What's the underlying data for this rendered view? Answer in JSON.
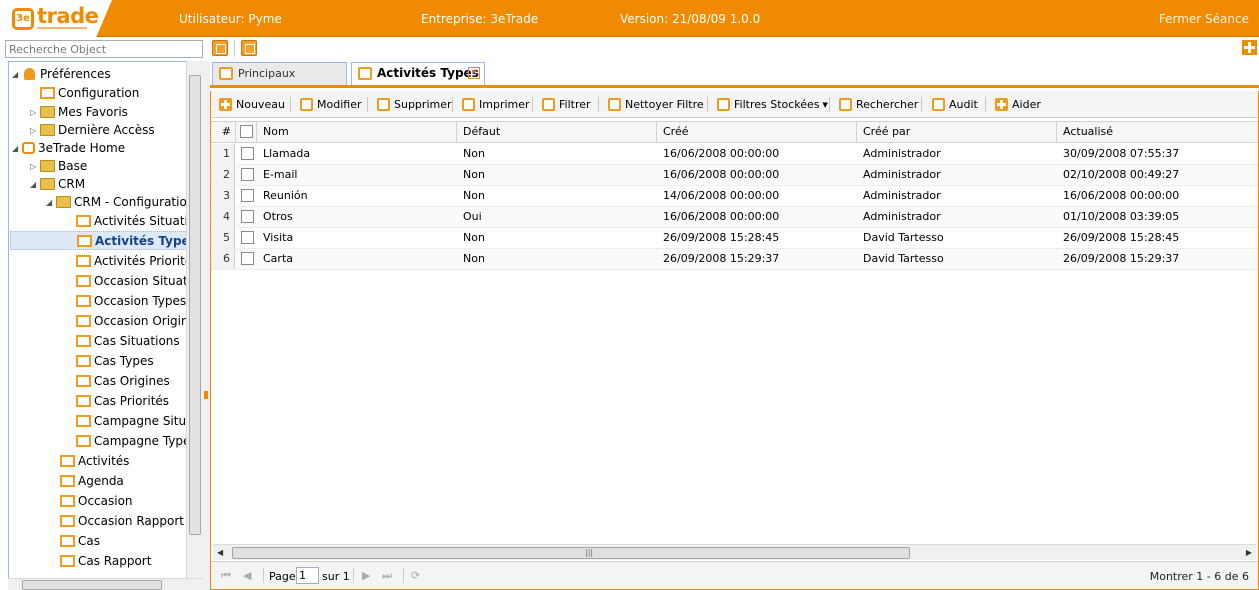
{
  "header": {
    "logo_text": "trade",
    "logo_mark": "3e",
    "user": "Utilisateur: Pyme",
    "company": "Entreprise: 3eTrade",
    "version": "Version: 21/08/09 1.0.0",
    "logout": "Fermer Séance"
  },
  "search": {
    "placeholder": "Recherche Object"
  },
  "tree": {
    "nodes": [
      {
        "label": "Préférences",
        "expanded": true,
        "icon": "user-icon"
      },
      {
        "label": "Configuration",
        "icon": "form-icon"
      },
      {
        "label": "Mes Favoris",
        "icon": "folder-icon"
      },
      {
        "label": "Dernière Accèss",
        "icon": "folder-icon"
      },
      {
        "label": "3eTrade Home",
        "expanded": true,
        "icon": "brand-icon"
      },
      {
        "label": "Base",
        "icon": "folder-icon"
      },
      {
        "label": "CRM",
        "expanded": true,
        "icon": "folder-icon"
      },
      {
        "label": "CRM - Configuration",
        "expanded": true,
        "icon": "folder-icon"
      },
      {
        "label": "Activités Situation",
        "icon": "form-icon"
      },
      {
        "label": "Activités Types",
        "icon": "form-icon",
        "selected": true
      },
      {
        "label": "Activités Priorités",
        "icon": "form-icon"
      },
      {
        "label": "Occasion Situation",
        "icon": "form-icon"
      },
      {
        "label": "Occasion Types",
        "icon": "form-icon"
      },
      {
        "label": "Occasion Origine",
        "icon": "form-icon"
      },
      {
        "label": "Cas Situations",
        "icon": "form-icon"
      },
      {
        "label": "Cas Types",
        "icon": "form-icon"
      },
      {
        "label": "Cas Origines",
        "icon": "form-icon"
      },
      {
        "label": "Cas Priorités",
        "icon": "form-icon"
      },
      {
        "label": "Campagne Situation",
        "icon": "form-icon"
      },
      {
        "label": "Campagne Types",
        "icon": "form-icon"
      },
      {
        "label": "Activités",
        "icon": "form-icon"
      },
      {
        "label": "Agenda",
        "icon": "form-icon"
      },
      {
        "label": "Occasion",
        "icon": "form-icon"
      },
      {
        "label": "Occasion Rapport",
        "icon": "form-icon"
      },
      {
        "label": "Cas",
        "icon": "form-icon"
      },
      {
        "label": "Cas Rapport",
        "icon": "form-icon"
      }
    ]
  },
  "tabs": [
    {
      "label": "Principaux",
      "active": false
    },
    {
      "label": "Activités Types",
      "active": true,
      "close": "✕"
    }
  ],
  "toolbar": {
    "nouveau": "Nouveau",
    "modifier": "Modifier",
    "supprimer": "Supprimer",
    "imprimer": "Imprimer",
    "filtrer": "Filtrer",
    "nettoyer": "Nettoyer Filtre",
    "filtres": "Filtres Stockées",
    "rechercher": "Rechercher",
    "audit": "Audit",
    "aider": "Aider"
  },
  "grid": {
    "columns": [
      "#",
      "Nom",
      "Défaut",
      "Créé",
      "Créé par",
      "Actualisé"
    ],
    "rows": [
      {
        "n": "1",
        "nom": "Llamada",
        "defaut": "Non",
        "cree": "16/06/2008 00:00:00",
        "cree_par": "Administrador",
        "actualise": "30/09/2008 07:55:37"
      },
      {
        "n": "2",
        "nom": "E-mail",
        "defaut": "Non",
        "cree": "16/06/2008 00:00:00",
        "cree_par": "Administrador",
        "actualise": "02/10/2008 00:49:27"
      },
      {
        "n": "3",
        "nom": "Reunión",
        "defaut": "Non",
        "cree": "14/06/2008 00:00:00",
        "cree_par": "Administrador",
        "actualise": "16/06/2008 00:00:00"
      },
      {
        "n": "4",
        "nom": "Otros",
        "defaut": "Oui",
        "cree": "16/06/2008 00:00:00",
        "cree_par": "Administrador",
        "actualise": "01/10/2008 03:39:05"
      },
      {
        "n": "5",
        "nom": "Visita",
        "defaut": "Non",
        "cree": "26/09/2008 15:28:45",
        "cree_par": "David Tartesso",
        "actualise": "26/09/2008 15:28:45"
      },
      {
        "n": "6",
        "nom": "Carta",
        "defaut": "Non",
        "cree": "26/09/2008 15:29:37",
        "cree_par": "David Tartesso",
        "actualise": "26/09/2008 15:29:37"
      }
    ]
  },
  "pager": {
    "page_label": "Page",
    "page_value": "1",
    "of_label": "sur 1",
    "info": "Montrer 1 - 6 de 6"
  },
  "colors": {
    "brand": "#f08a00",
    "header_text": "#ffffff"
  }
}
